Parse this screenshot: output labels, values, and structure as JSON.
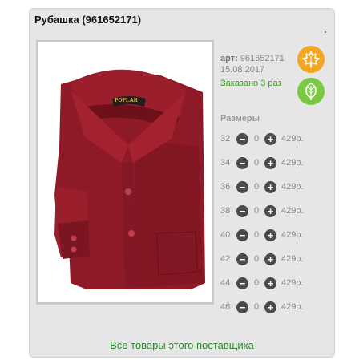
{
  "product": {
    "title": "Рубашка (961652171)",
    "art_label": "арт:",
    "art_value": "961652171",
    "date": "15.08.2017",
    "ordered": "Заказано 3 раз",
    "brand_label": "POPLAR"
  },
  "icons": {
    "season_autumn": "maple-leaf-icon",
    "eco": "leaf-icon"
  },
  "colors": {
    "badge_orange": "#f5a623",
    "badge_green": "#7bc943",
    "link_green": "#2b8a2b",
    "shirt": "#8e1a28"
  },
  "sizes": {
    "title": "Размеры",
    "rows": [
      {
        "size": "32",
        "qty": "0",
        "price": "429р."
      },
      {
        "size": "34",
        "qty": "0",
        "price": "429р."
      },
      {
        "size": "36",
        "qty": "0",
        "price": "429р."
      },
      {
        "size": "38",
        "qty": "0",
        "price": "429р."
      },
      {
        "size": "40",
        "qty": "0",
        "price": "429р."
      },
      {
        "size": "42",
        "qty": "0",
        "price": "429р."
      },
      {
        "size": "44",
        "qty": "0",
        "price": "429р."
      },
      {
        "size": "46",
        "qty": "0",
        "price": "429р."
      }
    ]
  },
  "footer": {
    "supplier_link": "Все товары этого поставщика"
  }
}
